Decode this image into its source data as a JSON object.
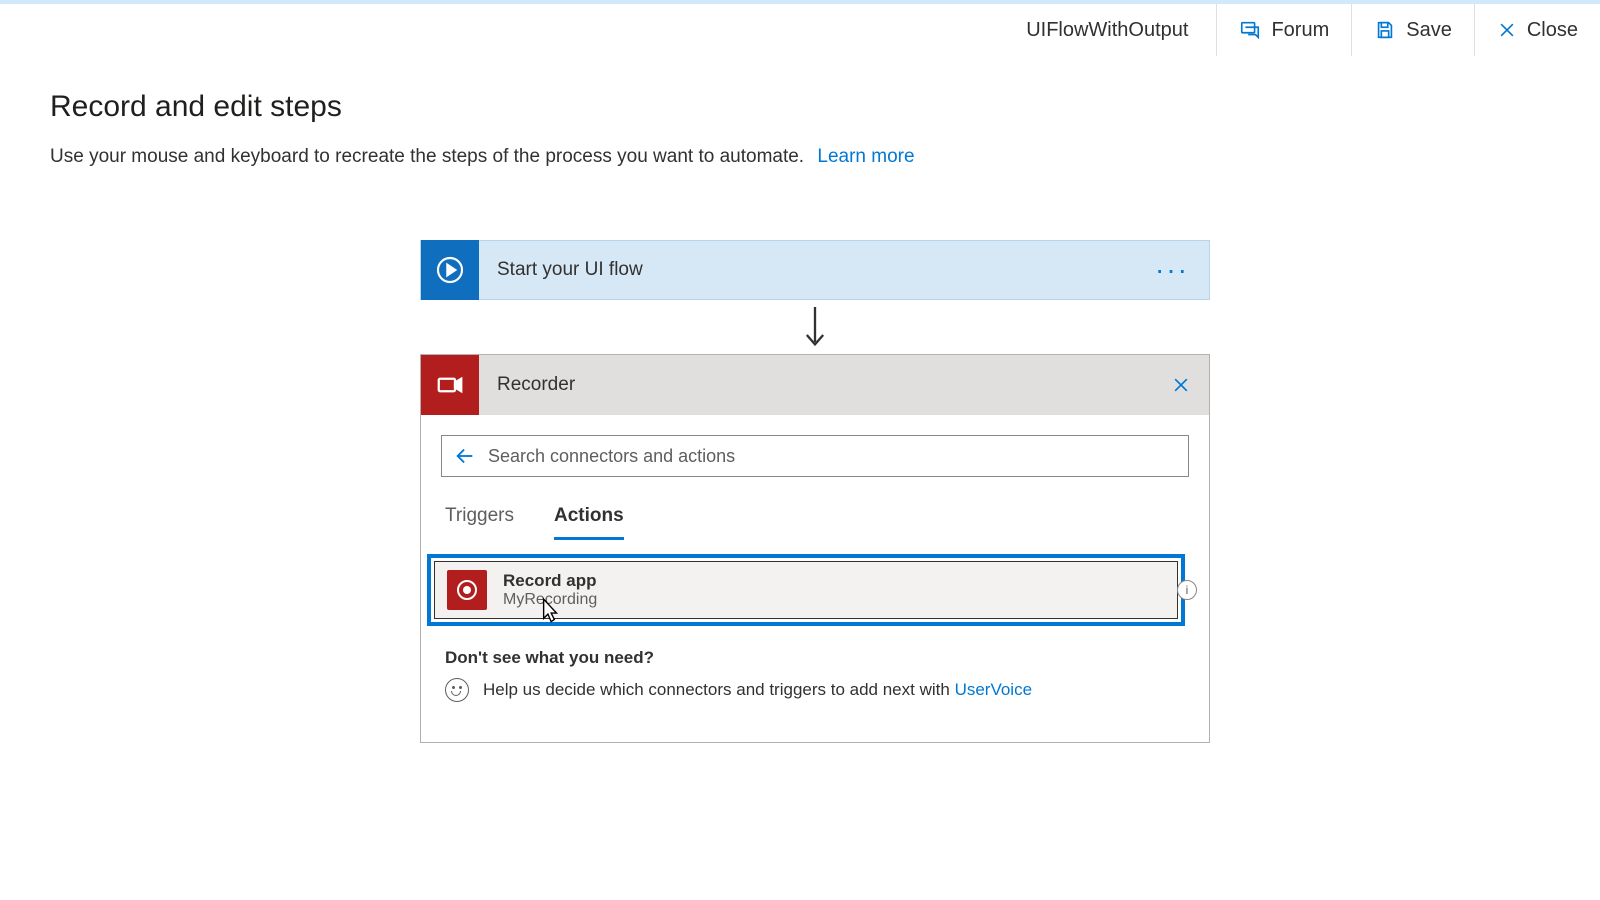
{
  "header": {
    "flow_name": "UIFlowWithOutput",
    "forum": "Forum",
    "save": "Save",
    "close": "Close"
  },
  "page": {
    "title": "Record and edit steps",
    "subtitle": "Use your mouse and keyboard to recreate the steps of the process you want to automate.",
    "learn_more": "Learn more"
  },
  "flow": {
    "start_label": "Start your UI flow"
  },
  "recorder": {
    "title": "Recorder",
    "search_placeholder": "Search connectors and actions",
    "tabs": {
      "triggers": "Triggers",
      "actions": "Actions"
    },
    "action": {
      "title": "Record app",
      "subtitle": "MyRecording"
    },
    "help": {
      "heading": "Don't see what you need?",
      "text": "Help us decide which connectors and triggers to add next with",
      "uservoice": "UserVoice"
    }
  }
}
